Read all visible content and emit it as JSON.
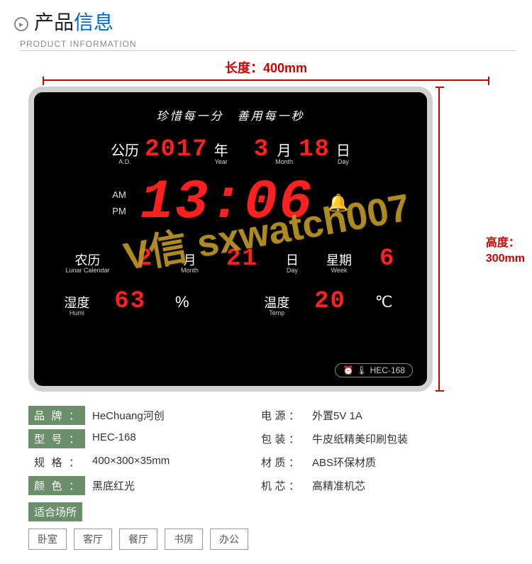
{
  "header": {
    "title_black": "产品",
    "title_blue": "信息",
    "subtitle": "PRODUCT INFORMATION"
  },
  "dimensions": {
    "width_label": "长度：400mm",
    "height_label_1": "高度：",
    "height_label_2": "300mm"
  },
  "clock": {
    "motto": "珍惜每一分　善用每一秒",
    "ad_cn": "公历",
    "ad_en": "A.D.",
    "year": "2017",
    "year_cn": "年",
    "year_en": "Year",
    "month": "3",
    "month_cn": "月",
    "month_en": "Month",
    "day": "18",
    "day_cn": "日",
    "day_en": "Day",
    "am": "AM",
    "pm": "PM",
    "time": "13:06",
    "lunar_cn": "农历",
    "lunar_en": "Lunar Calendar",
    "lunar_month": "2",
    "lunar_day": "21",
    "week_cn": "星期",
    "week_en": "Week",
    "week_val": "6",
    "humi_cn": "湿度",
    "humi_en": "Humi",
    "humi_val": "63",
    "humi_unit": "%",
    "temp_cn": "温度",
    "temp_en": "Temp",
    "temp_val": "20",
    "temp_unit": "℃",
    "model": "HEC-168"
  },
  "watermark": "V信 sxwatch007",
  "specs": {
    "brand_l": "品牌：",
    "brand_v": "HeChuang河创",
    "power_l": "电源：",
    "power_v": "外置5V  1A",
    "model_l": "型号：",
    "model_v": "HEC-168",
    "pack_l": "包装：",
    "pack_v": "牛皮纸精美印刷包装",
    "size_l": "规格：",
    "size_v": "400×300×35mm",
    "mat_l": "材质：",
    "mat_v": "ABS环保材质",
    "color_l": "颜色：",
    "color_v": "黑底红光",
    "move_l": "机芯：",
    "move_v": "高精准机芯"
  },
  "places": {
    "label": "适合场所",
    "items": [
      "卧室",
      "客厅",
      "餐厅",
      "书房",
      "办公"
    ]
  }
}
